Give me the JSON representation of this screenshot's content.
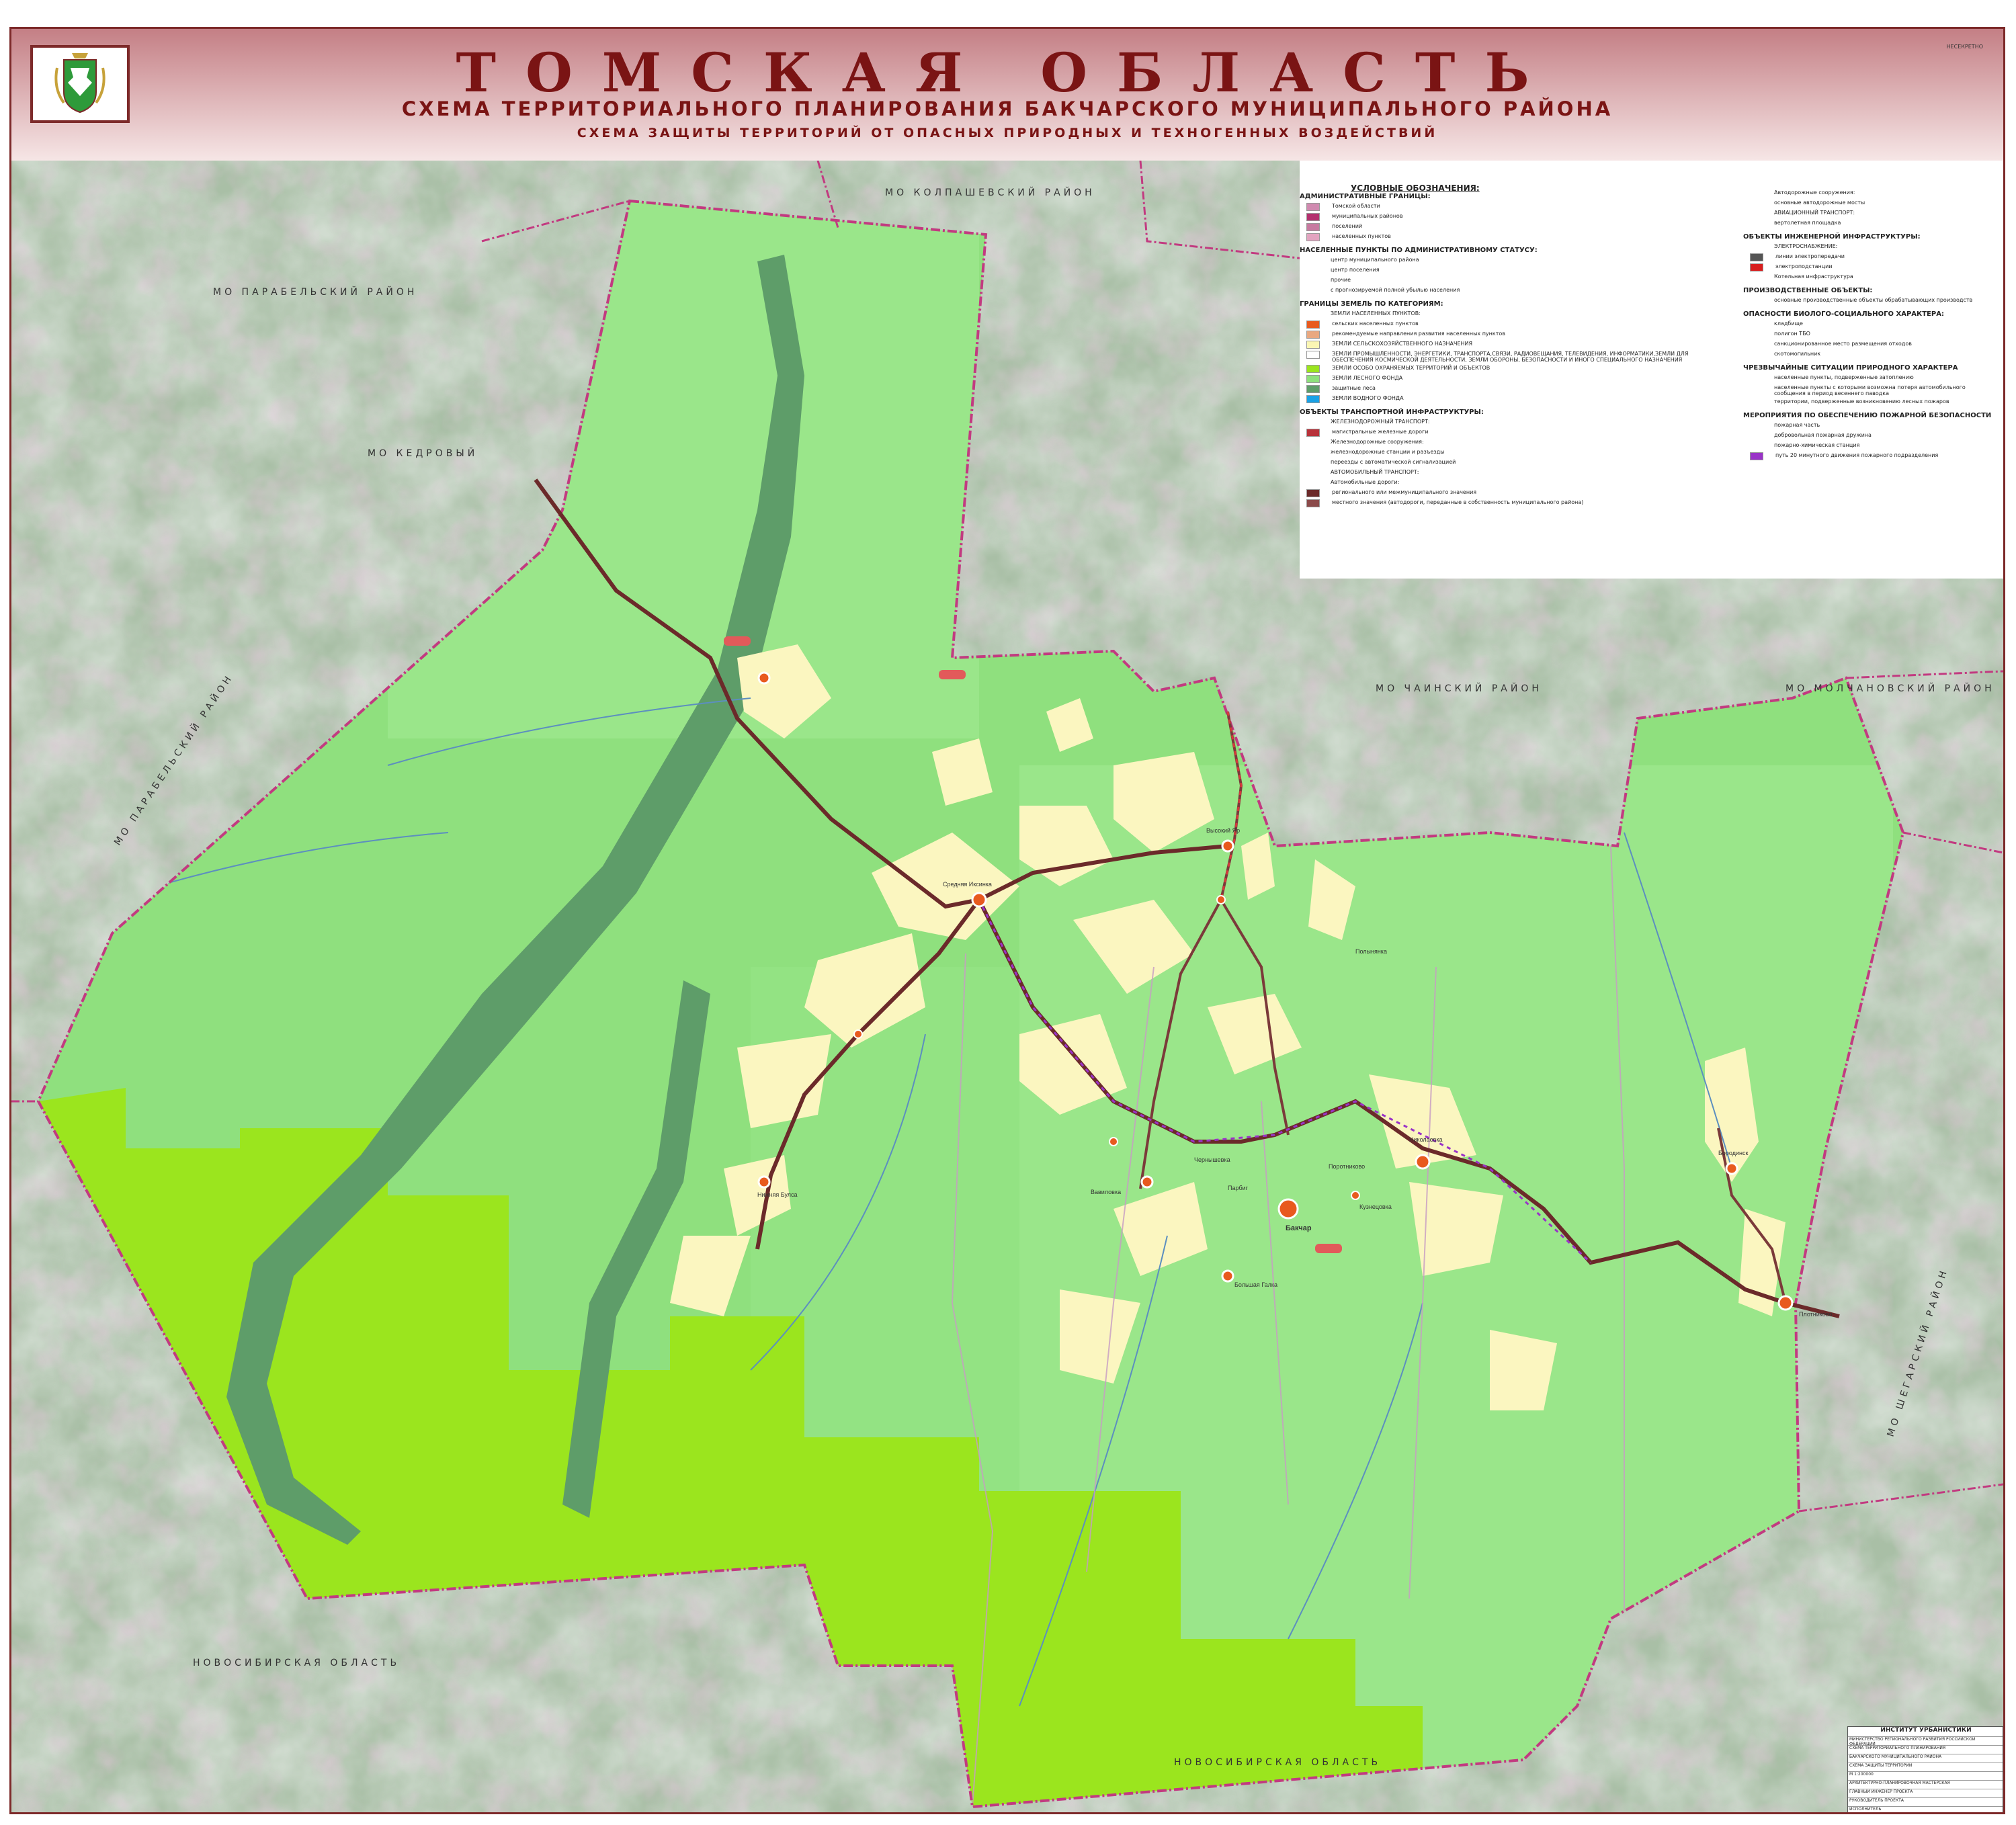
{
  "header": {
    "title": "ТОМСКАЯ ОБЛАСТЬ",
    "subtitle": "СХЕМА ТЕРРИТОРИАЛЬНОГО ПЛАНИРОВАНИЯ БАКЧАРСКОГО МУНИЦИПАЛЬНОГО РАЙОНА",
    "subtitle2": "СХЕМА ЗАЩИТЫ ТЕРРИТОРИЙ ОТ ОПАСНЫХ ПРИРОДНЫХ И ТЕХНОГЕННЫХ ВОЗДЕЙСТВИЙ",
    "stamp": "НЕСЕКРЕТНО"
  },
  "neighbors": {
    "north": "МО КОЛПАШЕВСКИЙ РАЙОН",
    "northwest": "МО ПАРАБЕЛЬСКИЙ РАЙОН",
    "kedrovy": "МО КЕДРОВЫЙ",
    "west": "МО ПАРАБЕЛЬСКИЙ РАЙОН",
    "east": "МО ЧАИНСКИЙ РАЙОН",
    "east2": "МО МОЛЧАНОВСКИЙ РАЙОН",
    "far_east": "МО ШЕГАРСКИЙ РАЙОН",
    "south": "НОВОСИБИРСКАЯ ОБЛАСТЬ",
    "south2": "НОВОСИБИРСКАЯ ОБЛАСТЬ"
  },
  "settlements": [
    {
      "name": "Бакчар"
    },
    {
      "name": "Средняя Иксинка"
    },
    {
      "name": "Высокий Яр"
    },
    {
      "name": "Парбиг"
    },
    {
      "name": "Вавиловка"
    },
    {
      "name": "Плотниково"
    },
    {
      "name": "Большая Галка"
    },
    {
      "name": "Поротниково"
    },
    {
      "name": "Кузнецовка"
    },
    {
      "name": "Полынянка"
    },
    {
      "name": "Чернышевка"
    },
    {
      "name": "Николаевка"
    },
    {
      "name": "Нижняя Булса"
    },
    {
      "name": "Бородинск"
    }
  ],
  "legend": {
    "main_title": "УСЛОВНЫЕ ОБОЗНАЧЕНИЯ:",
    "left": [
      {
        "type": "hdr",
        "text": "АДМИНИСТРАТИВНЫЕ ГРАНИЦЫ:"
      },
      {
        "type": "item",
        "text": "Томской области",
        "color": "#d08ab0"
      },
      {
        "type": "item",
        "text": "муниципальных районов",
        "color": "#b3306e"
      },
      {
        "type": "item",
        "text": "поселений",
        "color": "#c77aa0"
      },
      {
        "type": "item",
        "text": "населенных пунктов",
        "color": "#e2a4c0"
      },
      {
        "type": "hdr",
        "text": "НАСЕЛЕННЫЕ ПУНКТЫ ПО АДМИНИСТРАТИВНОМУ СТАТУСУ:"
      },
      {
        "type": "item",
        "text": "центр муниципального района",
        "color": ""
      },
      {
        "type": "item",
        "text": "центр поселения",
        "color": ""
      },
      {
        "type": "item",
        "text": "прочие",
        "color": ""
      },
      {
        "type": "item",
        "text": "с прогнозируемой полной убылью населения",
        "color": ""
      },
      {
        "type": "hdr",
        "text": "ГРАНИЦЫ ЗЕМЕЛЬ ПО КАТЕГОРИЯМ:"
      },
      {
        "type": "item",
        "text": "ЗЕМЛИ НАСЕЛЕННЫХ ПУНКТОВ:",
        "color": ""
      },
      {
        "type": "item",
        "text": "сельских населенных пунктов",
        "color": "#e85a1e"
      },
      {
        "type": "item",
        "text": "рекомендуемые направления развития населенных пунктов",
        "color": "#e9a880"
      },
      {
        "type": "item",
        "text": "ЗЕМЛИ СЕЛЬСКОХОЗЯЙСТВЕННОГО НАЗНАЧЕНИЯ",
        "color": "#fbf6b4"
      },
      {
        "type": "item",
        "text": "ЗЕМЛИ ПРОМЫШЛЕННОСТИ, ЭНЕРГЕТИКИ, ТРАНСПОРТА,СВЯЗИ, РАДИОВЕЩАНИЯ, ТЕЛЕВИДЕНИЯ, ИНФОРМАТИКИ,ЗЕМЛИ ДЛЯ ОБЕСПЕЧЕНИЯ КОСМИЧЕСКОЙ ДЕЯТЕЛЬНОСТИ, ЗЕМЛИ ОБОРОНЫ, БЕЗОПАСНОСТИ И ИНОГО СПЕЦИАЛЬНОГО НАЗНАЧЕНИЯ",
        "color": "#ffffff"
      },
      {
        "type": "item",
        "text": "ЗЕМЛИ ОСОБО ОХРАНЯЕМЫХ ТЕРРИТОРИЙ И ОБЪЕКТОВ",
        "color": "#9be51e"
      },
      {
        "type": "item",
        "text": "ЗЕМЛИ ЛЕСНОГО ФОНДА",
        "color": "#8ee07c"
      },
      {
        "type": "item",
        "text": "защитные леса",
        "color": "#5e9d69"
      },
      {
        "type": "item",
        "text": "ЗЕМЛИ ВОДНОГО ФОНДА",
        "color": "#1aa2e6"
      },
      {
        "type": "hdr",
        "text": "ОБЪЕКТЫ ТРАНСПОРТНОЙ ИНФРАСТРУКТУРЫ:"
      },
      {
        "type": "item",
        "text": "ЖЕЛЕЗНОДОРОЖНЫЙ ТРАНСПОРТ:",
        "color": ""
      },
      {
        "type": "item",
        "text": "магистральные железные дороги",
        "color": "#b8323a"
      },
      {
        "type": "item",
        "text": "Железнодорожные сооружения:",
        "color": ""
      },
      {
        "type": "item",
        "text": "железнодорожные станции и разъезды",
        "color": ""
      },
      {
        "type": "item",
        "text": "переезды с автоматической сигнализацией",
        "color": ""
      },
      {
        "type": "item",
        "text": "АВТОМОБИЛЬНЫЙ ТРАНСПОРТ:",
        "color": ""
      },
      {
        "type": "item",
        "text": "Автомобильные дороги:",
        "color": ""
      },
      {
        "type": "item",
        "text": "регионального или межмуниципального значения",
        "color": "#6b2a2a"
      },
      {
        "type": "item",
        "text": "местного значения (автодороги, переданные в собственность муниципального района)",
        "color": "#8b4a4a"
      }
    ],
    "right": [
      {
        "type": "item",
        "text": "Автодорожные сооружения:",
        "color": ""
      },
      {
        "type": "item",
        "text": "основные автодорожные мосты",
        "color": ""
      },
      {
        "type": "item",
        "text": "АВИАЦИОННЫЙ ТРАНСПОРТ:",
        "color": ""
      },
      {
        "type": "item",
        "text": "вертолетная площадка",
        "color": ""
      },
      {
        "type": "hdr",
        "text": "ОБЪЕКТЫ ИНЖЕНЕРНОЙ ИНФРАСТРУКТУРЫ:"
      },
      {
        "type": "item",
        "text": "ЭЛЕКТРОСНАБЖЕНИЕ:",
        "color": ""
      },
      {
        "type": "item",
        "text": "линии электропередачи",
        "color": "#555555"
      },
      {
        "type": "item",
        "text": "электроподстанции",
        "color": "#d81e1e"
      },
      {
        "type": "item",
        "text": "Котельная инфраструктура",
        "color": ""
      },
      {
        "type": "hdr",
        "text": "ПРОИЗВОДСТВЕННЫЕ ОБЪЕКТЫ:"
      },
      {
        "type": "item",
        "text": "основные производственные объекты обрабатывающих производств",
        "color": ""
      },
      {
        "type": "hdr",
        "text": "ОПАСНОСТИ БИОЛОГО-СОЦИАЛЬНОГО ХАРАКТЕРА:"
      },
      {
        "type": "item",
        "text": "кладбище",
        "color": ""
      },
      {
        "type": "item",
        "text": "полигон ТБО",
        "color": ""
      },
      {
        "type": "item",
        "text": "санкционированное место размещения отходов",
        "color": ""
      },
      {
        "type": "item",
        "text": "скотомогильник",
        "color": ""
      },
      {
        "type": "hdr",
        "text": "ЧРЕЗВЫЧАЙНЫЕ СИТУАЦИИ ПРИРОДНОГО ХАРАКТЕРА"
      },
      {
        "type": "item",
        "text": "населенные пункты, подверженные затоплению",
        "color": ""
      },
      {
        "type": "item",
        "text": "населенные пункты с которыми возможна потеря автомобильного сообщения в период весеннего паводка",
        "color": ""
      },
      {
        "type": "item",
        "text": "территории, подверженные возникновению лесных пожаров",
        "color": ""
      },
      {
        "type": "hdr",
        "text": "МЕРОПРИЯТИЯ ПО ОБЕСПЕЧЕНИЮ ПОЖАРНОЙ БЕЗОПАСНОСТИ"
      },
      {
        "type": "item",
        "text": "пожарная часть",
        "color": ""
      },
      {
        "type": "item",
        "text": "добровольная пожарная дружина",
        "color": ""
      },
      {
        "type": "item",
        "text": "пожарно-химическая станция",
        "color": ""
      },
      {
        "type": "item",
        "text": "путь 20 минутного движения пожарного подразделения",
        "color": "#9a33c8"
      }
    ]
  },
  "title_block": {
    "org": "ИНСТИТУТ УРБАНИСТИКИ",
    "rows": [
      "МИНИСТЕРСТВО РЕГИОНАЛЬНОГО РАЗВИТИЯ РОССИЙСКОЙ ФЕДЕРАЦИИ",
      "СХЕМА ТЕРРИТОРИАЛЬНОГО ПЛАНИРОВАНИЯ",
      "БАКЧАРСКОГО МУНИЦИПАЛЬНОГО РАЙОНА",
      "СХЕМА ЗАЩИТЫ ТЕРРИТОРИЙ",
      "М 1:200000",
      "АРХИТЕКТУРНО-ПЛАНИРОВОЧНАЯ МАСТЕРСКАЯ",
      "ГЛАВНЫЙ ИНЖЕНЕР ПРОЕКТА",
      "РУКОВОДИТЕЛЬ ПРОЕКТА",
      "ИСПОЛНИТЕЛЬ",
      "ПРОВЕРИЛ"
    ]
  },
  "colors": {
    "forest": "#8fe07e",
    "forest_light": "#9ae68a",
    "protected": "#9be51e",
    "farmland": "#fbf6c0",
    "protective_forest": "#5e9d69",
    "road": "#6b2a2a",
    "border": "#c23a80"
  }
}
